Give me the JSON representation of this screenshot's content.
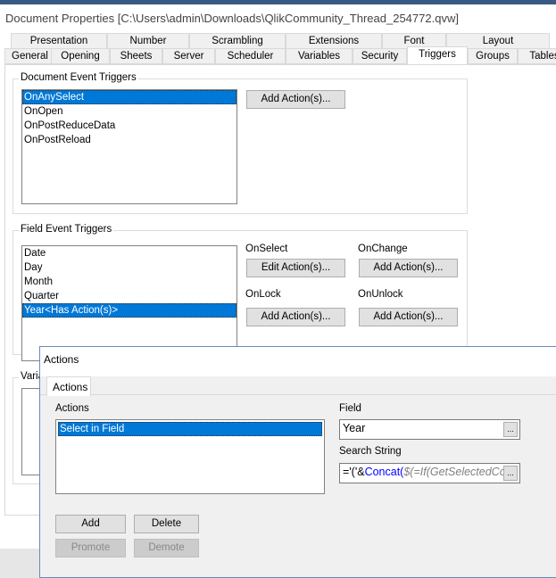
{
  "window": {
    "title": "Document Properties [C:\\Users\\admin\\Downloads\\QlikCommunity_Thread_254772.qvw]"
  },
  "tabs_row1": [
    "Presentation",
    "Number",
    "Scrambling",
    "Extensions",
    "Font",
    "Layout"
  ],
  "tabs_row2": [
    "General",
    "Opening",
    "Sheets",
    "Server",
    "Scheduler",
    "Variables",
    "Security",
    "Triggers",
    "Groups",
    "Tables"
  ],
  "active_tab": "Triggers",
  "document_triggers": {
    "label": "Document Event Triggers",
    "items": [
      "OnAnySelect",
      "OnOpen",
      "OnPostReduceData",
      "OnPostReload"
    ],
    "selected": "OnAnySelect",
    "add_button": "Add Action(s)..."
  },
  "field_triggers": {
    "label": "Field Event Triggers",
    "items": [
      "Date",
      "Day",
      "Month",
      "Quarter",
      "Year<Has Action(s)>"
    ],
    "selected": "Year<Has Action(s)>",
    "on_select": "OnSelect",
    "on_select_button": "Edit Action(s)...",
    "on_change": "OnChange",
    "on_change_button": "Add Action(s)...",
    "on_lock": "OnLock",
    "on_lock_button": "Add Action(s)...",
    "on_unlock": "OnUnlock",
    "on_unlock_button": "Add Action(s)..."
  },
  "variable_triggers": {
    "label": "Varia"
  },
  "actions_dialog": {
    "title": "Actions",
    "tab": "Actions",
    "list_label": "Actions",
    "items": [
      "Select in Field"
    ],
    "selected": "Select in Field",
    "field_label": "Field",
    "field_value": "Year",
    "search_label": "Search String",
    "search_parts": [
      "='('&",
      "Concat(",
      "$(=If(GetSelectedCo"
    ],
    "browse": "...",
    "add": "Add",
    "delete": "Delete",
    "promote": "Promote",
    "demote": "Demote"
  },
  "colors": {
    "selection": "#0078d7",
    "function": "#0000ff",
    "expression": "#808080"
  }
}
